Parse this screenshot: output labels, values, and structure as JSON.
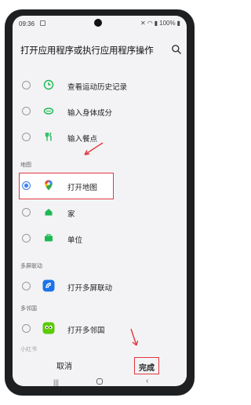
{
  "status": {
    "time": "09:36",
    "battery": "100%"
  },
  "header": {
    "title": "打开应用程序或执行应用程序操作"
  },
  "rows": [
    {
      "label": "查看运动历史记录",
      "icon": "clock-icon",
      "checked": false
    },
    {
      "label": "输入身体成分",
      "icon": "body-composition-icon",
      "checked": false
    },
    {
      "label": "输入餐点",
      "icon": "cutlery-icon",
      "checked": false
    },
    {
      "label": "打开地图",
      "icon": "map-pin-icon",
      "checked": true
    },
    {
      "label": "家",
      "icon": "home-icon",
      "checked": false
    },
    {
      "label": "单位",
      "icon": "briefcase-icon",
      "checked": false
    },
    {
      "label": "打开多屏联动",
      "icon": "multi-screen-icon",
      "checked": false
    },
    {
      "label": "打开多邻国",
      "icon": "duolingo-icon",
      "checked": false
    }
  ],
  "sections": {
    "map": "地图",
    "multiscreen": "多屏联动",
    "duolingo": "多邻国",
    "xiaohongshu": "小红书"
  },
  "footer": {
    "cancel": "取消",
    "done": "完成"
  },
  "colors": {
    "accent": "#3c82f6",
    "annotation": "#e0383e",
    "health_green": "#1db954"
  }
}
